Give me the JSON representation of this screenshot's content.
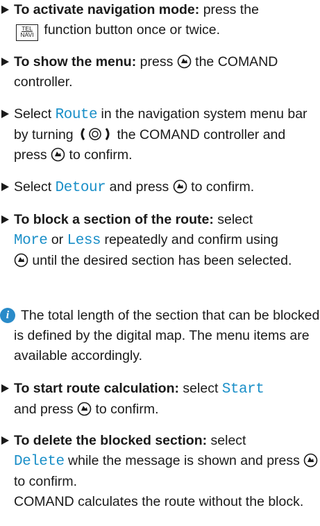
{
  "steps": [
    {
      "bold": "To activate navigation mode:",
      "pre": " press the",
      "button_top": "TEL",
      "button_bottom": "NAVI",
      "post": " function button once or twice."
    },
    {
      "bold": "To show the menu:",
      "pre": " press",
      "post": " the COMAND controller."
    },
    {
      "pre": "Select ",
      "mono1": "Route",
      "mid": " in the navigation system menu bar by turning",
      "mid2": " the COMAND controller and press",
      "post": " to confirm."
    },
    {
      "pre": "Select ",
      "mono1": "Detour",
      "post": " and press",
      "post2": " to confirm."
    },
    {
      "bold": "To block a section of the route:",
      "pre": " select",
      "mono1": "More",
      "mid": " or ",
      "mono2": "Less",
      "post": " repeatedly and confirm using",
      "post2": " until the desired section has been selected."
    },
    {
      "bold": "To start route calculation:",
      "pre": " select ",
      "mono1": "Start",
      "post": "and press",
      "post2": " to confirm."
    },
    {
      "bold": "To delete the blocked section:",
      "pre": " select",
      "mono1": "Delete",
      "post": " while the message is shown and press",
      "post2": " to confirm.",
      "extra": "COMAND calculates the route without the block."
    }
  ],
  "note": {
    "icon": "i",
    "text": "The total length of the section that can be blocked is defined by the digital map. The menu items are available accordingly."
  },
  "icons": {
    "controller_press": "controller-press-icon",
    "controller_rotate": "controller-rotate-icon",
    "info": "info-icon"
  },
  "colors": {
    "text": "#1a1a1a",
    "display_text": "#1a8fc8",
    "info_icon": "#2a8bc9"
  }
}
